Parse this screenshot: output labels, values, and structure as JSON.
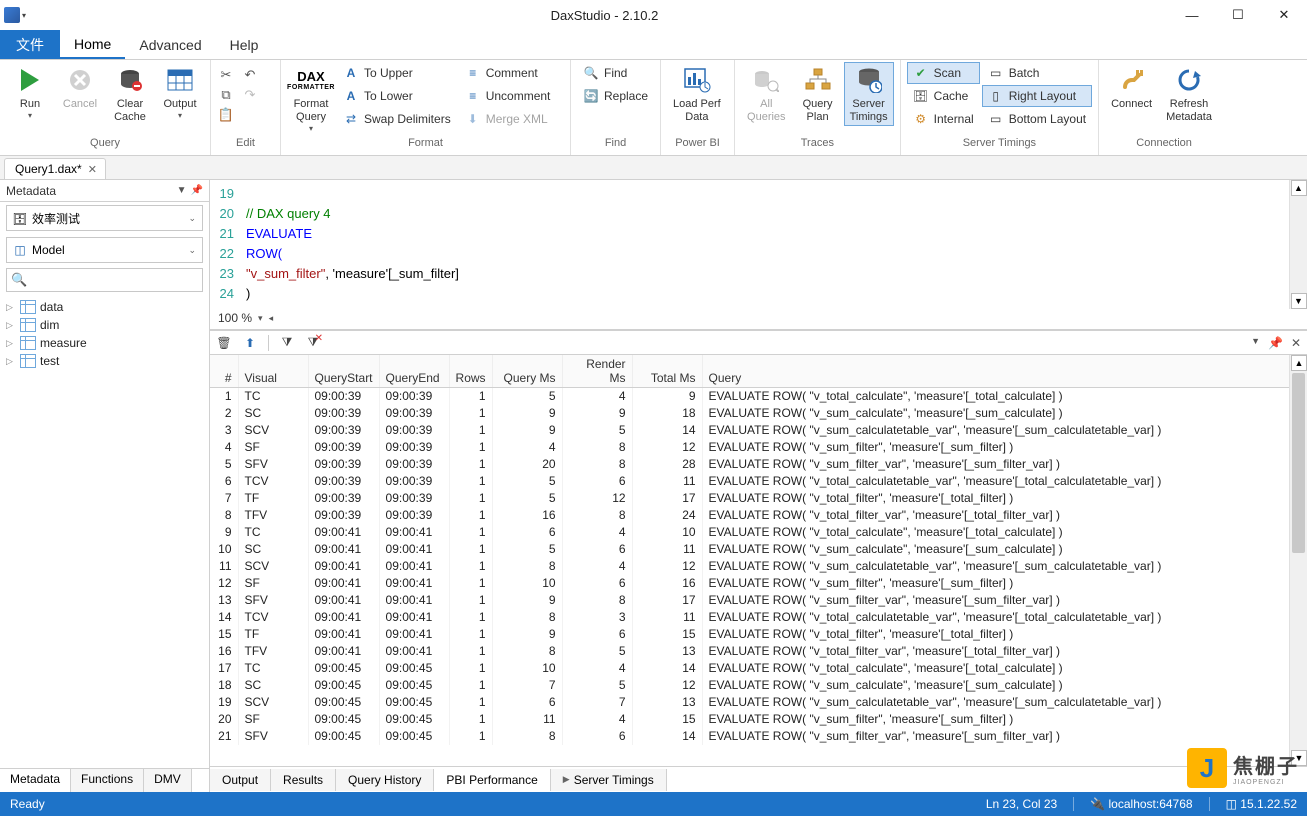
{
  "title": "DaxStudio - 2.10.2",
  "menubar": {
    "file": "文件",
    "home": "Home",
    "advanced": "Advanced",
    "help": "Help"
  },
  "ribbon": {
    "query": {
      "run": "Run",
      "cancel": "Cancel",
      "clear_cache": "Clear\nCache",
      "output": "Output",
      "label": "Query"
    },
    "edit": {
      "label": "Edit"
    },
    "format": {
      "format_query": "Format\nQuery",
      "to_upper": "To Upper",
      "to_lower": "To Lower",
      "swap": "Swap Delimiters",
      "comment": "Comment",
      "uncomment": "Uncomment",
      "merge_xml": "Merge XML",
      "label": "Format"
    },
    "find": {
      "find": "Find",
      "replace": "Replace",
      "label": "Find"
    },
    "powerbi": {
      "load_perf": "Load Perf\nData",
      "label": "Power BI"
    },
    "traces": {
      "all_queries": "All\nQueries",
      "query_plan": "Query\nPlan",
      "server_timings": "Server\nTimings",
      "label": "Traces"
    },
    "server_timings": {
      "scan": "Scan",
      "cache": "Cache",
      "internal": "Internal",
      "batch": "Batch",
      "right_layout": "Right Layout",
      "bottom_layout": "Bottom Layout",
      "label": "Server Timings"
    },
    "connection": {
      "connect": "Connect",
      "refresh": "Refresh\nMetadata",
      "label": "Connection"
    }
  },
  "doc_tab": "Query1.dax*",
  "sidebar": {
    "title": "Metadata",
    "db": "效率测试",
    "model": "Model",
    "tables": [
      "data",
      "dim",
      "measure",
      "test"
    ],
    "tabs": {
      "metadata": "Metadata",
      "functions": "Functions",
      "dmv": "DMV"
    }
  },
  "editor": {
    "lines": [
      {
        "n": 19,
        "t": ""
      },
      {
        "n": 20,
        "cls": "c-comment",
        "t": "// DAX query 4"
      },
      {
        "n": 21,
        "cls": "c-kw",
        "t": "EVALUATE"
      },
      {
        "n": 22,
        "cls": "c-kw",
        "t": "ROW("
      },
      {
        "n": 23,
        "t": "\"v_sum_filter\", 'measure'[_sum_filter]",
        "str": true
      },
      {
        "n": 24,
        "t": ")"
      }
    ],
    "zoom": "100 %"
  },
  "grid": {
    "headers": [
      "#",
      "Visual",
      "QueryStart",
      "QueryEnd",
      "Rows",
      "Query Ms",
      "Render Ms",
      "Total Ms",
      "Query"
    ],
    "rows": [
      [
        1,
        "TC",
        "09:00:39",
        "09:00:39",
        1,
        5,
        4,
        9,
        "EVALUATE ROW( \"v_total_calculate\", 'measure'[_total_calculate] )"
      ],
      [
        2,
        "SC",
        "09:00:39",
        "09:00:39",
        1,
        9,
        9,
        18,
        "EVALUATE ROW( \"v_sum_calculate\", 'measure'[_sum_calculate] )"
      ],
      [
        3,
        "SCV",
        "09:00:39",
        "09:00:39",
        1,
        9,
        5,
        14,
        "EVALUATE ROW( \"v_sum_calculatetable_var\", 'measure'[_sum_calculatetable_var] )"
      ],
      [
        4,
        "SF",
        "09:00:39",
        "09:00:39",
        1,
        4,
        8,
        12,
        "EVALUATE ROW( \"v_sum_filter\", 'measure'[_sum_filter] )"
      ],
      [
        5,
        "SFV",
        "09:00:39",
        "09:00:39",
        1,
        20,
        8,
        28,
        "EVALUATE ROW( \"v_sum_filter_var\", 'measure'[_sum_filter_var] )"
      ],
      [
        6,
        "TCV",
        "09:00:39",
        "09:00:39",
        1,
        5,
        6,
        11,
        "EVALUATE ROW( \"v_total_calculatetable_var\", 'measure'[_total_calculatetable_var] )"
      ],
      [
        7,
        "TF",
        "09:00:39",
        "09:00:39",
        1,
        5,
        12,
        17,
        "EVALUATE ROW( \"v_total_filter\", 'measure'[_total_filter] )"
      ],
      [
        8,
        "TFV",
        "09:00:39",
        "09:00:39",
        1,
        16,
        8,
        24,
        "EVALUATE ROW( \"v_total_filter_var\", 'measure'[_total_filter_var] )"
      ],
      [
        9,
        "TC",
        "09:00:41",
        "09:00:41",
        1,
        6,
        4,
        10,
        "EVALUATE ROW( \"v_total_calculate\", 'measure'[_total_calculate] )"
      ],
      [
        10,
        "SC",
        "09:00:41",
        "09:00:41",
        1,
        5,
        6,
        11,
        "EVALUATE ROW( \"v_sum_calculate\", 'measure'[_sum_calculate] )"
      ],
      [
        11,
        "SCV",
        "09:00:41",
        "09:00:41",
        1,
        8,
        4,
        12,
        "EVALUATE ROW( \"v_sum_calculatetable_var\", 'measure'[_sum_calculatetable_var] )"
      ],
      [
        12,
        "SF",
        "09:00:41",
        "09:00:41",
        1,
        10,
        6,
        16,
        "EVALUATE ROW( \"v_sum_filter\", 'measure'[_sum_filter] )"
      ],
      [
        13,
        "SFV",
        "09:00:41",
        "09:00:41",
        1,
        9,
        8,
        17,
        "EVALUATE ROW( \"v_sum_filter_var\", 'measure'[_sum_filter_var] )"
      ],
      [
        14,
        "TCV",
        "09:00:41",
        "09:00:41",
        1,
        8,
        3,
        11,
        "EVALUATE ROW( \"v_total_calculatetable_var\", 'measure'[_total_calculatetable_var] )"
      ],
      [
        15,
        "TF",
        "09:00:41",
        "09:00:41",
        1,
        9,
        6,
        15,
        "EVALUATE ROW( \"v_total_filter\", 'measure'[_total_filter] )"
      ],
      [
        16,
        "TFV",
        "09:00:41",
        "09:00:41",
        1,
        8,
        5,
        13,
        "EVALUATE ROW( \"v_total_filter_var\", 'measure'[_total_filter_var] )"
      ],
      [
        17,
        "TC",
        "09:00:45",
        "09:00:45",
        1,
        10,
        4,
        14,
        "EVALUATE ROW( \"v_total_calculate\", 'measure'[_total_calculate] )"
      ],
      [
        18,
        "SC",
        "09:00:45",
        "09:00:45",
        1,
        7,
        5,
        12,
        "EVALUATE ROW( \"v_sum_calculate\", 'measure'[_sum_calculate] )"
      ],
      [
        19,
        "SCV",
        "09:00:45",
        "09:00:45",
        1,
        6,
        7,
        13,
        "EVALUATE ROW( \"v_sum_calculatetable_var\", 'measure'[_sum_calculatetable_var] )"
      ],
      [
        20,
        "SF",
        "09:00:45",
        "09:00:45",
        1,
        11,
        4,
        15,
        "EVALUATE ROW( \"v_sum_filter\", 'measure'[_sum_filter] )"
      ],
      [
        21,
        "SFV",
        "09:00:45",
        "09:00:45",
        1,
        8,
        6,
        14,
        "EVALUATE ROW( \"v_sum_filter_var\", 'measure'[_sum_filter_var] )"
      ]
    ]
  },
  "bottom_tabs": {
    "output": "Output",
    "results": "Results",
    "query_history": "Query History",
    "pbi_perf": "PBI Performance",
    "server_timings": "Server Timings"
  },
  "status": {
    "ready": "Ready",
    "pos": "Ln 23, Col 23",
    "host": "localhost:64768",
    "ver": "15.1.22.52"
  },
  "watermark": {
    "main": "焦棚子",
    "sub": "JIAOPENGZI"
  }
}
